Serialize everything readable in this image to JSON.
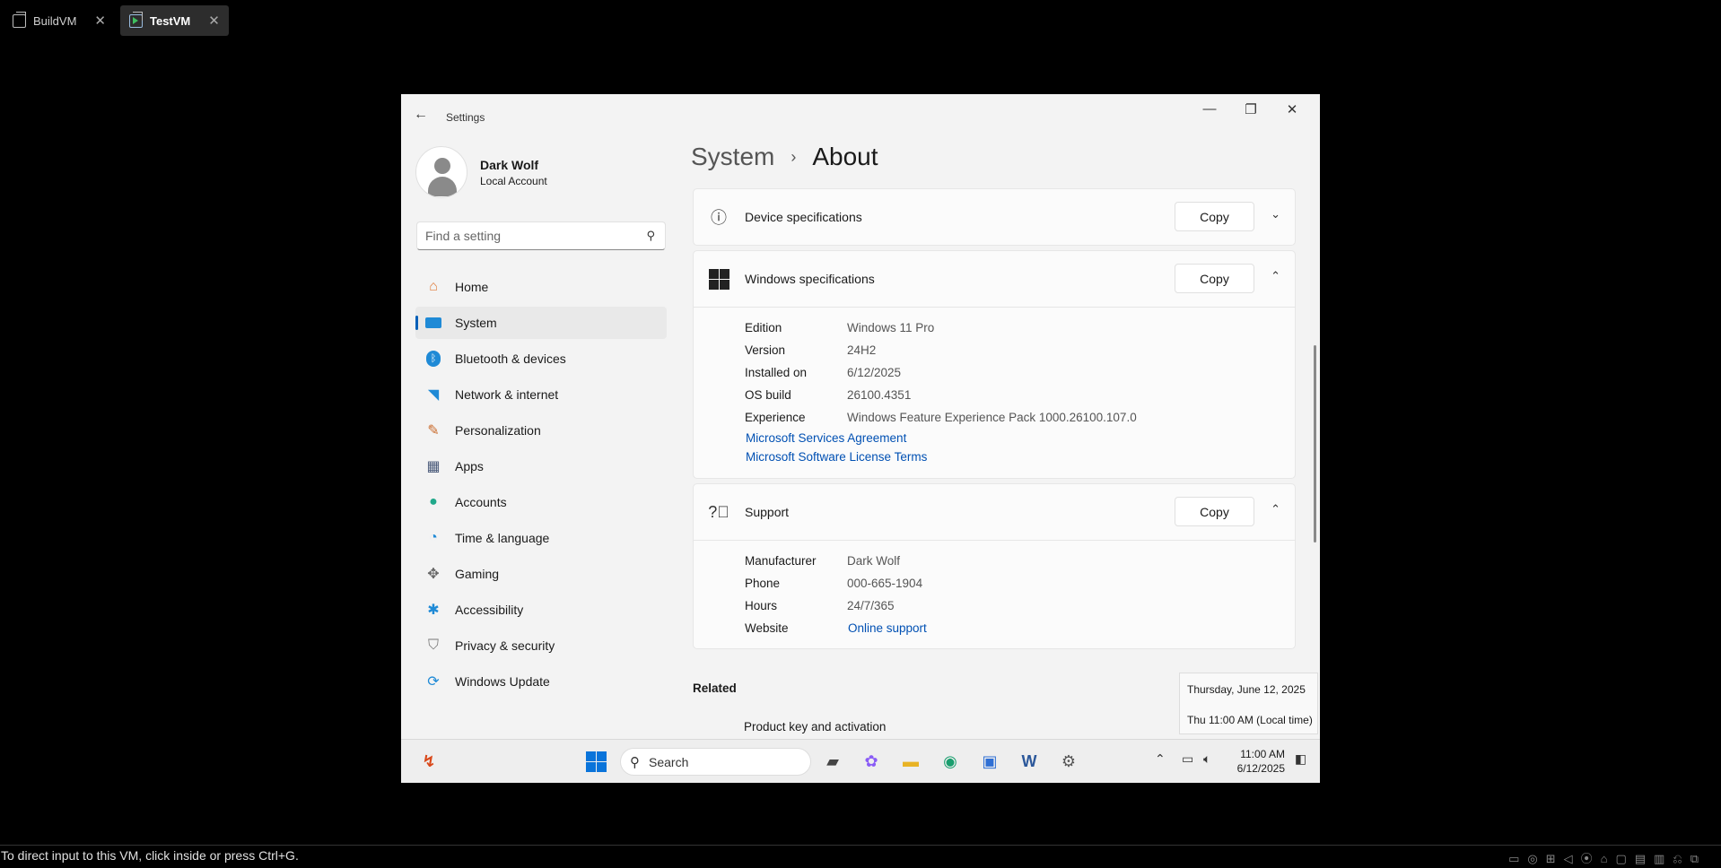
{
  "vm_tabs": [
    {
      "label": "BuildVM",
      "active": false
    },
    {
      "label": "TestVM",
      "active": true
    }
  ],
  "settings": {
    "app_title": "Settings",
    "profile": {
      "name": "Dark Wolf",
      "account_type": "Local Account"
    },
    "search_placeholder": "Find a setting",
    "nav": [
      {
        "label": "Home",
        "icon": "home-icon"
      },
      {
        "label": "System",
        "icon": "system-icon",
        "selected": true
      },
      {
        "label": "Bluetooth & devices",
        "icon": "bluetooth-icon"
      },
      {
        "label": "Network & internet",
        "icon": "wifi-icon"
      },
      {
        "label": "Personalization",
        "icon": "brush-icon"
      },
      {
        "label": "Apps",
        "icon": "apps-icon"
      },
      {
        "label": "Accounts",
        "icon": "person-icon"
      },
      {
        "label": "Time & language",
        "icon": "globe-clock-icon"
      },
      {
        "label": "Gaming",
        "icon": "controller-icon"
      },
      {
        "label": "Accessibility",
        "icon": "accessibility-icon"
      },
      {
        "label": "Privacy & security",
        "icon": "shield-icon"
      },
      {
        "label": "Windows Update",
        "icon": "update-icon"
      }
    ],
    "breadcrumb": {
      "parent": "System",
      "current": "About"
    },
    "device_specs": {
      "label": "Device specifications",
      "copy": "Copy"
    },
    "windows_specs": {
      "label": "Windows specifications",
      "copy": "Copy",
      "rows": [
        {
          "key": "Edition",
          "value": "Windows 11 Pro"
        },
        {
          "key": "Version",
          "value": "24H2"
        },
        {
          "key": "Installed on",
          "value": "6/12/2025"
        },
        {
          "key": "OS build",
          "value": "26100.4351"
        },
        {
          "key": "Experience",
          "value": "Windows Feature Experience Pack 1000.26100.107.0"
        }
      ],
      "links": [
        "Microsoft Services Agreement",
        "Microsoft Software License Terms"
      ]
    },
    "support": {
      "label": "Support",
      "copy": "Copy",
      "rows": [
        {
          "key": "Manufacturer",
          "value": "Dark Wolf"
        },
        {
          "key": "Phone",
          "value": "000-665-1904"
        },
        {
          "key": "Hours",
          "value": "24/7/365"
        }
      ],
      "website_key": "Website",
      "website_link": "Online support"
    },
    "related_header": "Related",
    "related_item": "Product key and activation"
  },
  "tooltip": {
    "line1": "Thursday, June 12, 2025",
    "line2": "Thu 11:00 AM (Local time)"
  },
  "taskbar": {
    "search": "Search",
    "time": "11:00 AM",
    "date": "6/12/2025"
  },
  "statusbar": {
    "text": "To direct input to this VM, click inside or press Ctrl+G."
  },
  "colors": {
    "accent": "#005fb8",
    "link": "#0050b3",
    "window_bg": "#f3f3f3"
  }
}
